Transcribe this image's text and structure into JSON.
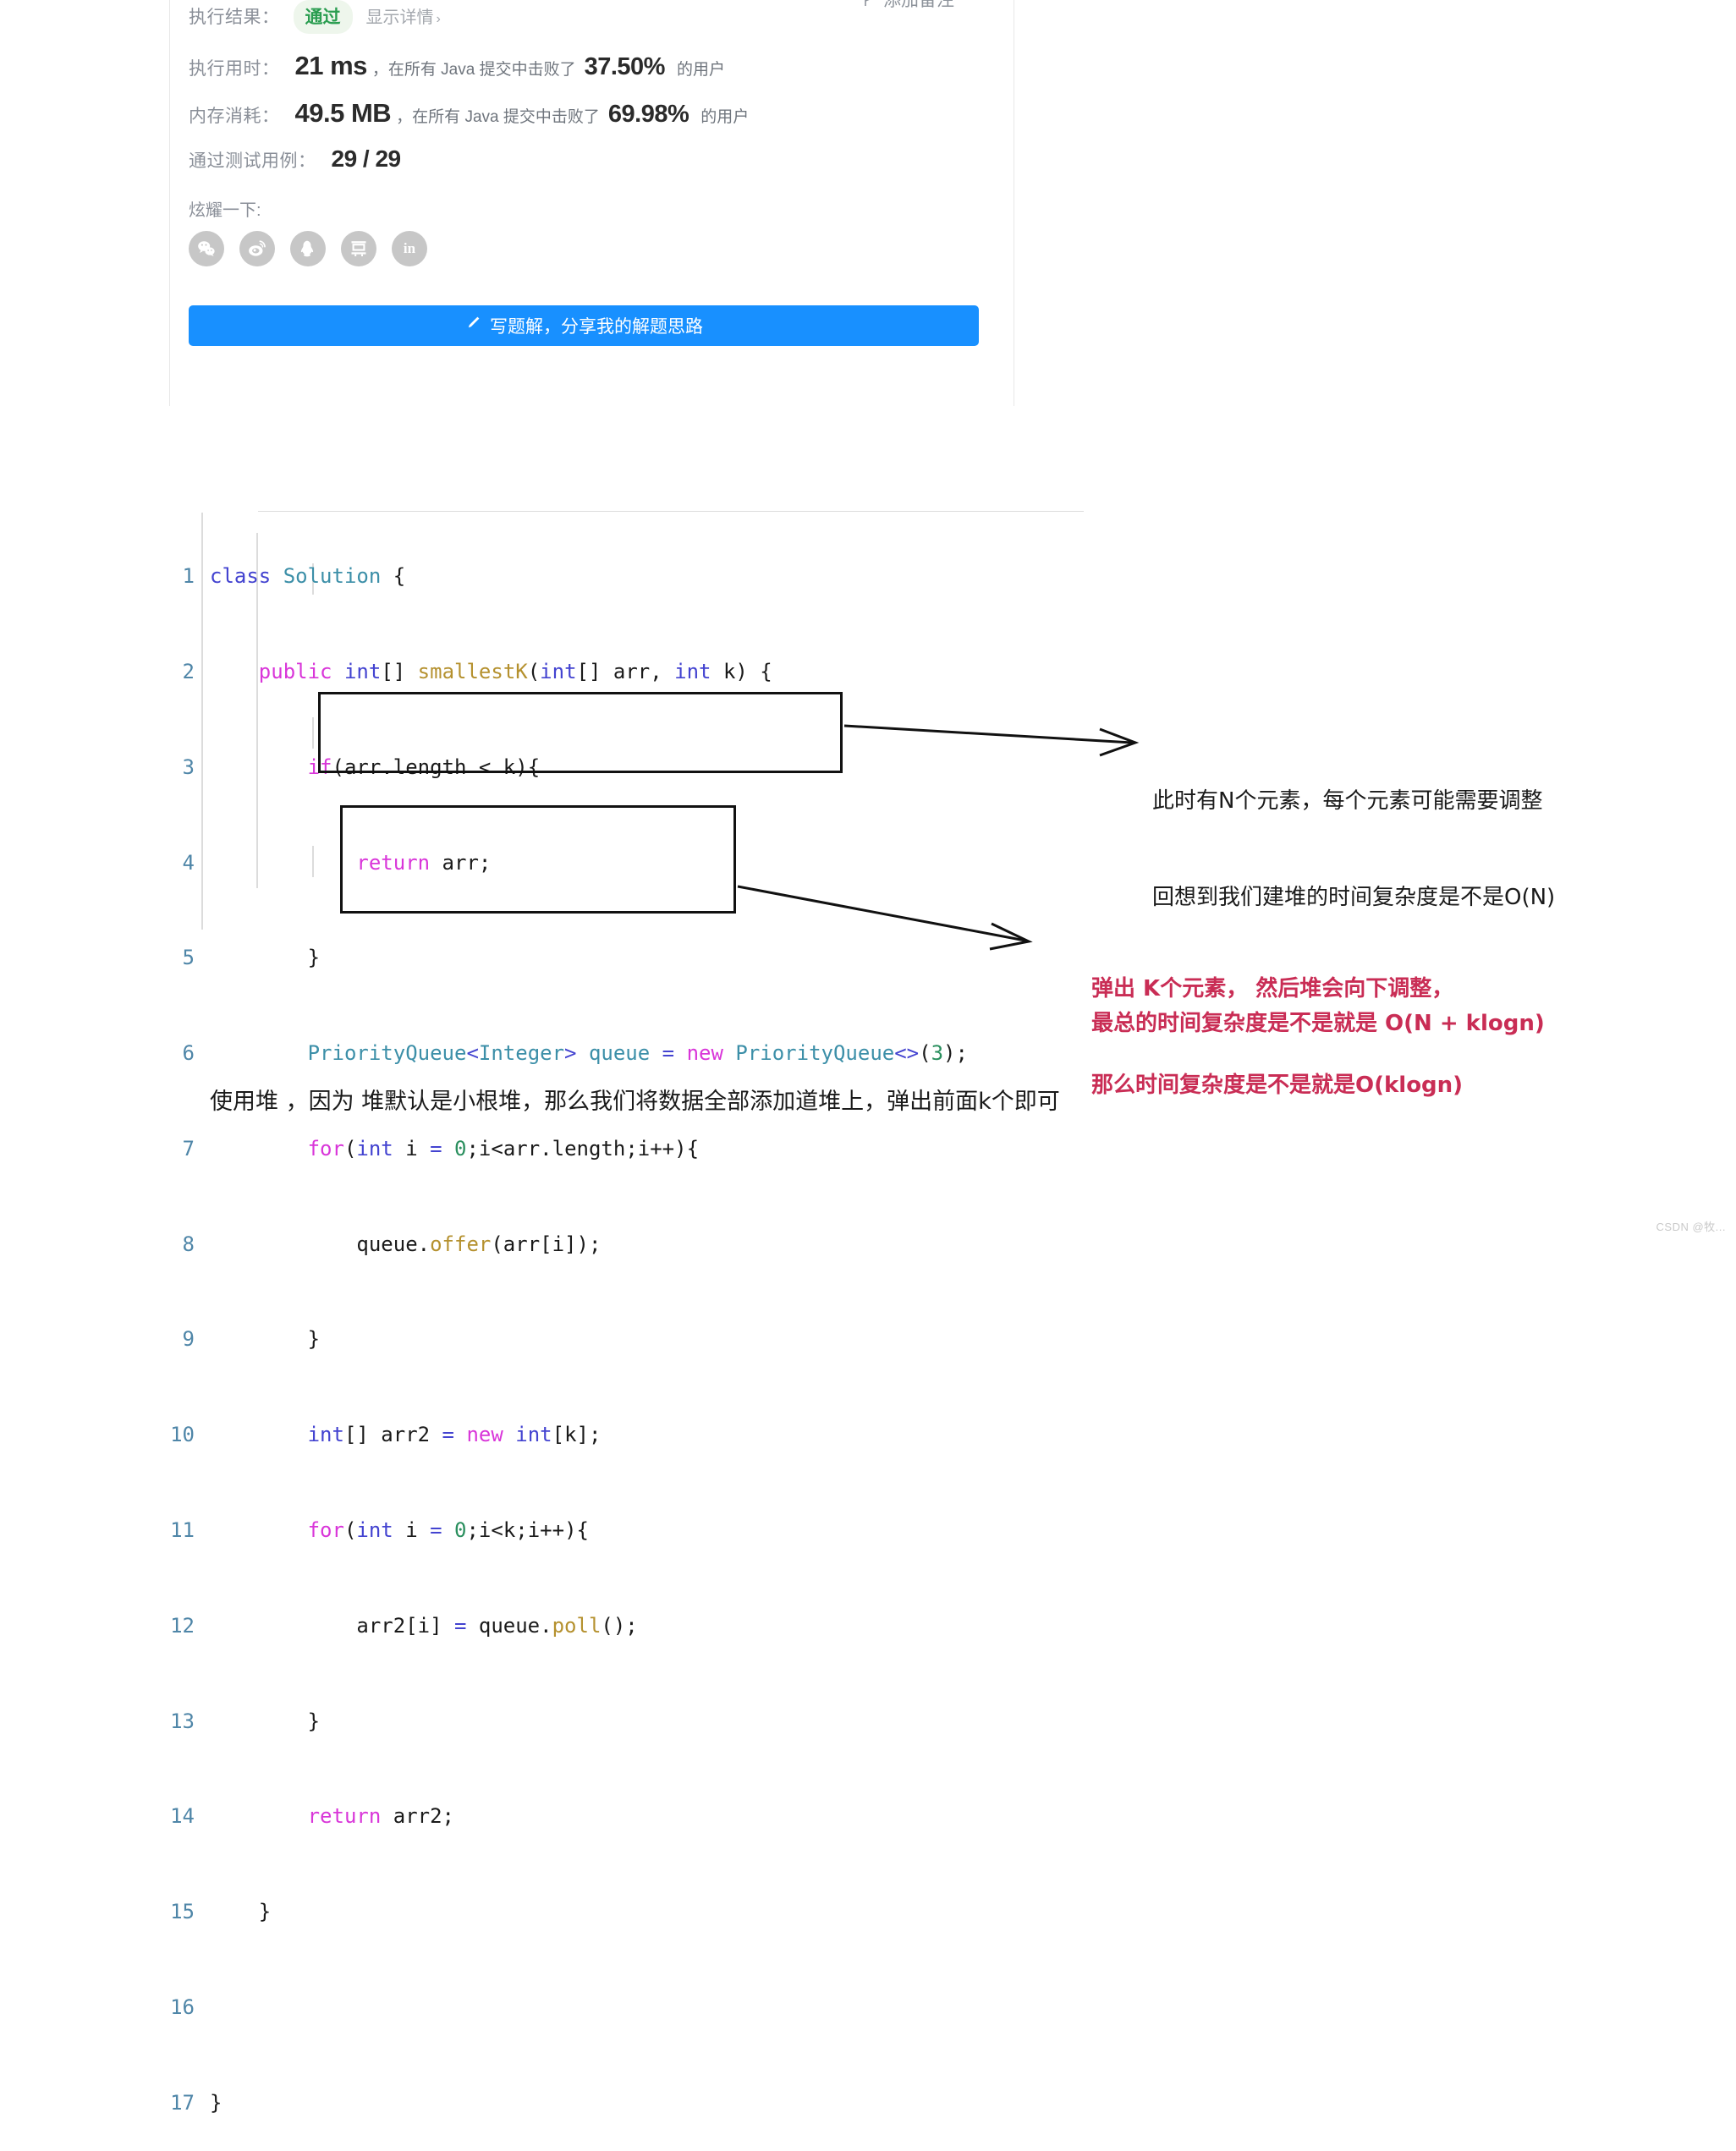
{
  "result_card": {
    "rows": {
      "exec_result_label": "执行结果：",
      "pass_badge": "通过",
      "show_detail": "显示详情",
      "chevron": "›",
      "add_note": "添加备注",
      "runtime_label": "执行用时：",
      "runtime_value": "21 ms",
      "runtime_mid": "，在所有 Java 提交中击败了",
      "runtime_pct": "37.50%",
      "runtime_tail": "的用户",
      "memory_label": "内存消耗：",
      "memory_value": "49.5 MB",
      "memory_mid": "，在所有 Java 提交中击败了",
      "memory_pct": "69.98%",
      "memory_tail": "的用户",
      "testcase_label": "通过测试用例：",
      "testcase_value": "29 / 29",
      "share_label": "炫耀一下:"
    },
    "share_buttons": [
      {
        "name": "wechat-share-button",
        "icon": "wechat-icon",
        "label": "微信"
      },
      {
        "name": "weibo-share-button",
        "icon": "weibo-icon",
        "label": "微博"
      },
      {
        "name": "qq-share-button",
        "icon": "qq-icon",
        "label": "QQ"
      },
      {
        "name": "douban-share-button",
        "icon": "douban-icon",
        "label": "豆瓣"
      },
      {
        "name": "linkedin-share-button",
        "icon": "linkedin-icon",
        "label": "in"
      }
    ],
    "write_solution_button": "写题解，分享我的解题思路",
    "accent_blue": "#1890ff",
    "pass_green": "#2a9d50"
  },
  "code": {
    "language": "java",
    "line_numbers": [
      "1",
      "2",
      "3",
      "4",
      "5",
      "6",
      "7",
      "8",
      "9",
      "10",
      "11",
      "12",
      "13",
      "14",
      "15",
      "16",
      "17"
    ],
    "lines": [
      "class Solution {",
      "    public int[] smallestK(int[] arr, int k) {",
      "        if(arr.length < k){",
      "            return arr;",
      "        }",
      "        PriorityQueue<Integer> queue = new PriorityQueue<>(3);",
      "        for(int i = 0;i<arr.length;i++){",
      "            queue.offer(arr[i]);",
      "        }",
      "        int[] arr2 = new int[k];",
      "        for(int i = 0;i<k;i++){",
      "            arr2[i] = queue.poll();",
      "        }",
      "        return arr2;",
      "    }",
      "",
      "}"
    ]
  },
  "annotations": {
    "black_note_line1": "此时有N个元素，每个元素可能需要调整",
    "black_note_line2": "回想到我们建堆的时间复杂度是不是O(N)",
    "red_note_line1": "弹出 K个元素， 然后堆会向下调整，",
    "red_note_line2": "那么时间复杂度是不是就是O(klogn)",
    "red_note_line3": "最总的时间复杂度是不是就是 O(N + klogn)",
    "red_color": "#c92d55"
  },
  "bottom_note": "使用堆 ，因为 堆默认是小根堆，那么我们将数据全部添加道堆上，弹出前面k个即可",
  "watermark": "CSDN @牧..."
}
